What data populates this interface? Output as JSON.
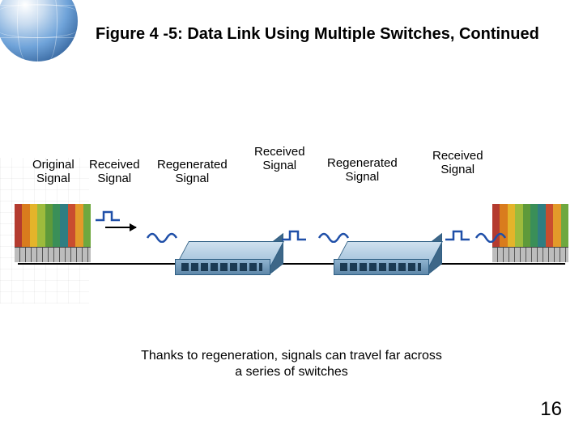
{
  "title": "Figure 4 -5: Data Link Using Multiple Switches, Continued",
  "labels": {
    "original": "Original\nSignal",
    "received1": "Received\nSignal",
    "regen1": "Regenerated\nSignal",
    "received2": "Received\nSignal",
    "regen2": "Regenerated\nSignal",
    "received3": "Received\nSignal"
  },
  "caption": "Thanks to regeneration, signals can travel far across\na series of switches",
  "page": "16",
  "icons": {
    "globe": "globe-icon",
    "endpoint": "fiber-endpoint-device",
    "switch": "network-switch",
    "arrow": "direction-arrow"
  },
  "chart_data": {
    "type": "diagram",
    "note": "Network data-link with two switches regenerating a signal between two endpoint devices. Labels left→right: Original Signal, Received Signal, Regenerated Signal, Received Signal, Regenerated Signal, Received Signal."
  }
}
